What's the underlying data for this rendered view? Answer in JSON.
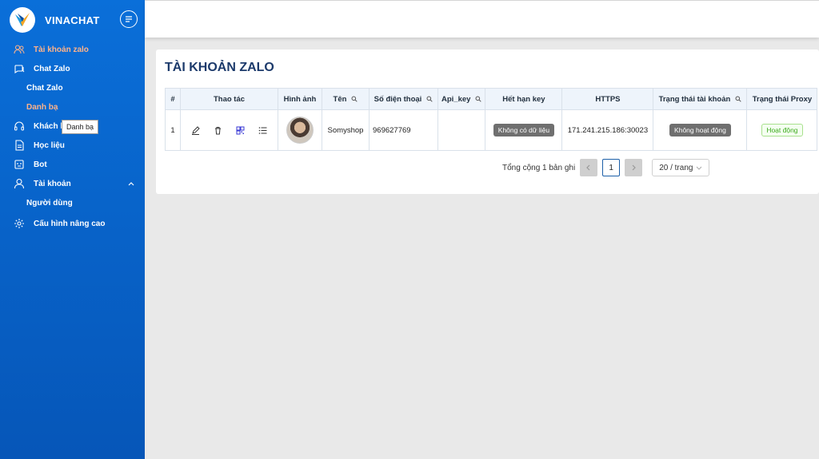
{
  "brand": "VINACHAT",
  "tooltip": "Danh bạ",
  "nav": {
    "items": [
      {
        "label": "Tài khoản zalo"
      },
      {
        "label": "Chat Zalo"
      },
      {
        "label": "Chat Zalo"
      },
      {
        "label": "Danh bạ"
      },
      {
        "label": "Khách h"
      },
      {
        "label": "Học liệu"
      },
      {
        "label": "Bot"
      },
      {
        "label": "Tài khoản"
      },
      {
        "label": "Người dùng"
      },
      {
        "label": "Cấu hình nâng cao"
      }
    ]
  },
  "page": {
    "title": "TÀI KHOẢN ZALO"
  },
  "table": {
    "headers": [
      "#",
      "Thao tác",
      "Hình ảnh",
      "Tên",
      "Số điện thoại",
      "Api_key",
      "Hết hạn key",
      "HTTPS",
      "Trạng thái tài khoản",
      "Trạng thái Proxy"
    ],
    "rows": [
      {
        "index": "1",
        "name": "Somyshop",
        "phone": "969627769",
        "api_key": "",
        "key_expiry": "Không có dữ liệu",
        "https": "171.241.215.186:30023",
        "account_status": "Không hoạt động",
        "proxy_status": "Hoạt động"
      }
    ]
  },
  "pagination": {
    "total_text": "Tổng cộng 1 bản ghi",
    "current_page": "1",
    "page_size": "20 / trang"
  },
  "colors": {
    "sidebar": "#0a6fd9",
    "active_nav": "#ffb38a",
    "title": "#1c3a6b",
    "tag_gray": "#6f6f6f",
    "tag_green": "#3eaa1f"
  }
}
